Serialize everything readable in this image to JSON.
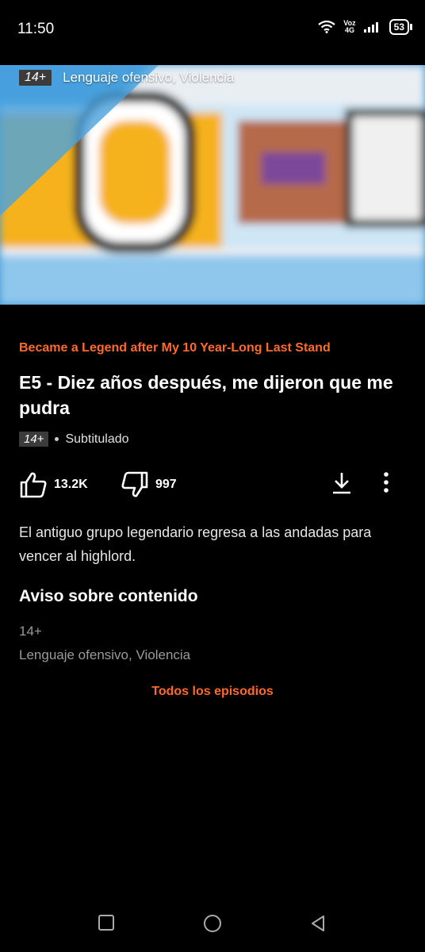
{
  "status_bar": {
    "time": "11:50",
    "network_label_top": "Voz",
    "network_label_bottom": "4G",
    "battery": "53",
    "icons": [
      "wifi-icon",
      "signal-icon",
      "battery-icon"
    ]
  },
  "hero": {
    "rating": "14+",
    "content_descriptors": "Lenguaje ofensivo, Violencia"
  },
  "episode": {
    "series_title": "Became a Legend after My 10 Year-Long Last Stand",
    "title": "E5 - Diez años después, me dijeron que me pudra",
    "rating": "14+",
    "audio_type": "Subtitulado",
    "likes": "13.2K",
    "dislikes": "997",
    "description": "El antiguo grupo legendario regresa a las andadas para vencer al highlord."
  },
  "advisory": {
    "heading": "Aviso sobre contenido",
    "rating": "14+",
    "descriptors": "Lenguaje ofensivo, Violencia"
  },
  "links": {
    "all_episodes": "Todos los episodios"
  },
  "colors": {
    "accent": "#ff6a2b",
    "background": "#000000",
    "muted_text": "#9a9a9a"
  }
}
